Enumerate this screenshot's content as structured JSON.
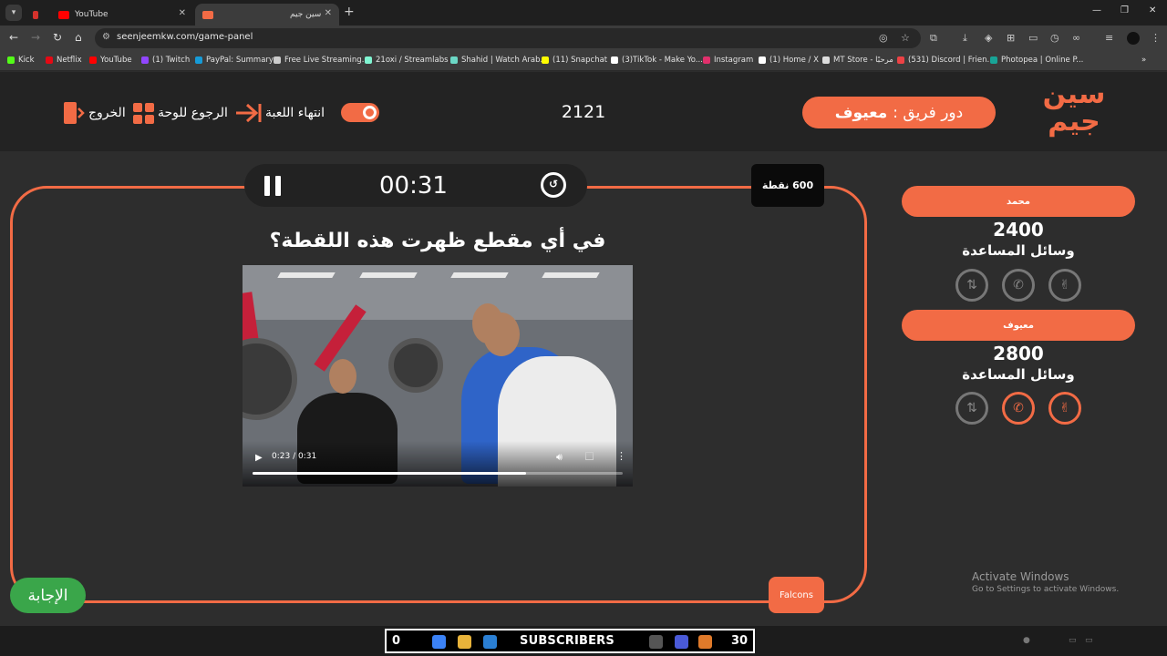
{
  "browser": {
    "tabs": [
      {
        "label": "",
        "favicon_color": "#d4322c",
        "active": false
      },
      {
        "label": "YouTube",
        "favicon_color": "#ff0000",
        "active": false
      },
      {
        "label": "سين جيم",
        "favicon_color": "#f26b45",
        "active": true
      }
    ],
    "new_tab": "+",
    "window_controls": {
      "minimize": "—",
      "restore": "❐",
      "close": "✕"
    },
    "url": "seenjeemkw.com/game-panel",
    "bookmarks": [
      {
        "label": "Kick",
        "color": "#53fc18"
      },
      {
        "label": "Netflix",
        "color": "#e50914"
      },
      {
        "label": "YouTube",
        "color": "#ff0000"
      },
      {
        "label": "(1) Twitch",
        "color": "#9146ff"
      },
      {
        "label": "PayPal: Summary",
        "color": "#169bd7"
      },
      {
        "label": "Free Live Streaming...",
        "color": "#cccccc"
      },
      {
        "label": "21oxi / Streamlabs",
        "color": "#80f5d2"
      },
      {
        "label": "Shahid | Watch Arab...",
        "color": "#6cd8c6"
      },
      {
        "label": "(11) Snapchat",
        "color": "#fffc00"
      },
      {
        "label": "(3)TikTok - Make Yo...",
        "color": "#ffffff"
      },
      {
        "label": "Instagram",
        "color": "#e1306c"
      },
      {
        "label": "(1) Home / X",
        "color": "#ffffff"
      },
      {
        "label": "MT Store - مرحبًا",
        "color": "#dddddd"
      },
      {
        "label": "(531) Discord | Frien...",
        "color": "#ed4245"
      },
      {
        "label": "Photopea | Online P...",
        "color": "#18a497"
      }
    ],
    "bookmarks_more": "»"
  },
  "header": {
    "logo_text": "سين جيم",
    "turn_prefix": "دور فريق :",
    "turn_team": "معيوف",
    "game_code": "2121",
    "end_game_label": "انتهاء اللعبة",
    "back_to_board_label": "الرجوع للوحة",
    "exit_label": "الخروج"
  },
  "board": {
    "timer": "00:31",
    "points": "600 نقطة",
    "question": "في أي مقطع ظهرت هذه اللقطة؟",
    "video": {
      "time": "0:23 / 0:31",
      "progress": 0.74
    },
    "answer_label": "الإجابة",
    "team_tag": "Falcons"
  },
  "teams": [
    {
      "name": "محمد",
      "score": "2400",
      "aids_label": "وسائل المساعدة",
      "aids": [
        {
          "icon": "swap-icon",
          "glyph": "⇅",
          "active": false
        },
        {
          "icon": "phone-icon",
          "glyph": "✆",
          "active": false
        },
        {
          "icon": "peace-hand-icon",
          "glyph": "✌",
          "active": false
        }
      ]
    },
    {
      "name": "معيوف",
      "score": "2800",
      "aids_label": "وسائل المساعدة",
      "aids": [
        {
          "icon": "swap-icon",
          "glyph": "⇅",
          "active": false
        },
        {
          "icon": "phone-icon",
          "glyph": "✆",
          "active": true
        },
        {
          "icon": "peace-hand-icon",
          "glyph": "✌",
          "active": true
        }
      ]
    }
  ],
  "activate_windows": {
    "title": "Activate Windows",
    "subtitle": "Go to Settings to activate Windows."
  },
  "taskbar": {
    "left_count": "0",
    "subscribers_label": "SUBSCRIBERS",
    "right_count": "30"
  },
  "colors": {
    "accent": "#f26b45",
    "answer_green": "#3aa64a",
    "background": "#2d2d2d",
    "header_bg": "#232323"
  }
}
